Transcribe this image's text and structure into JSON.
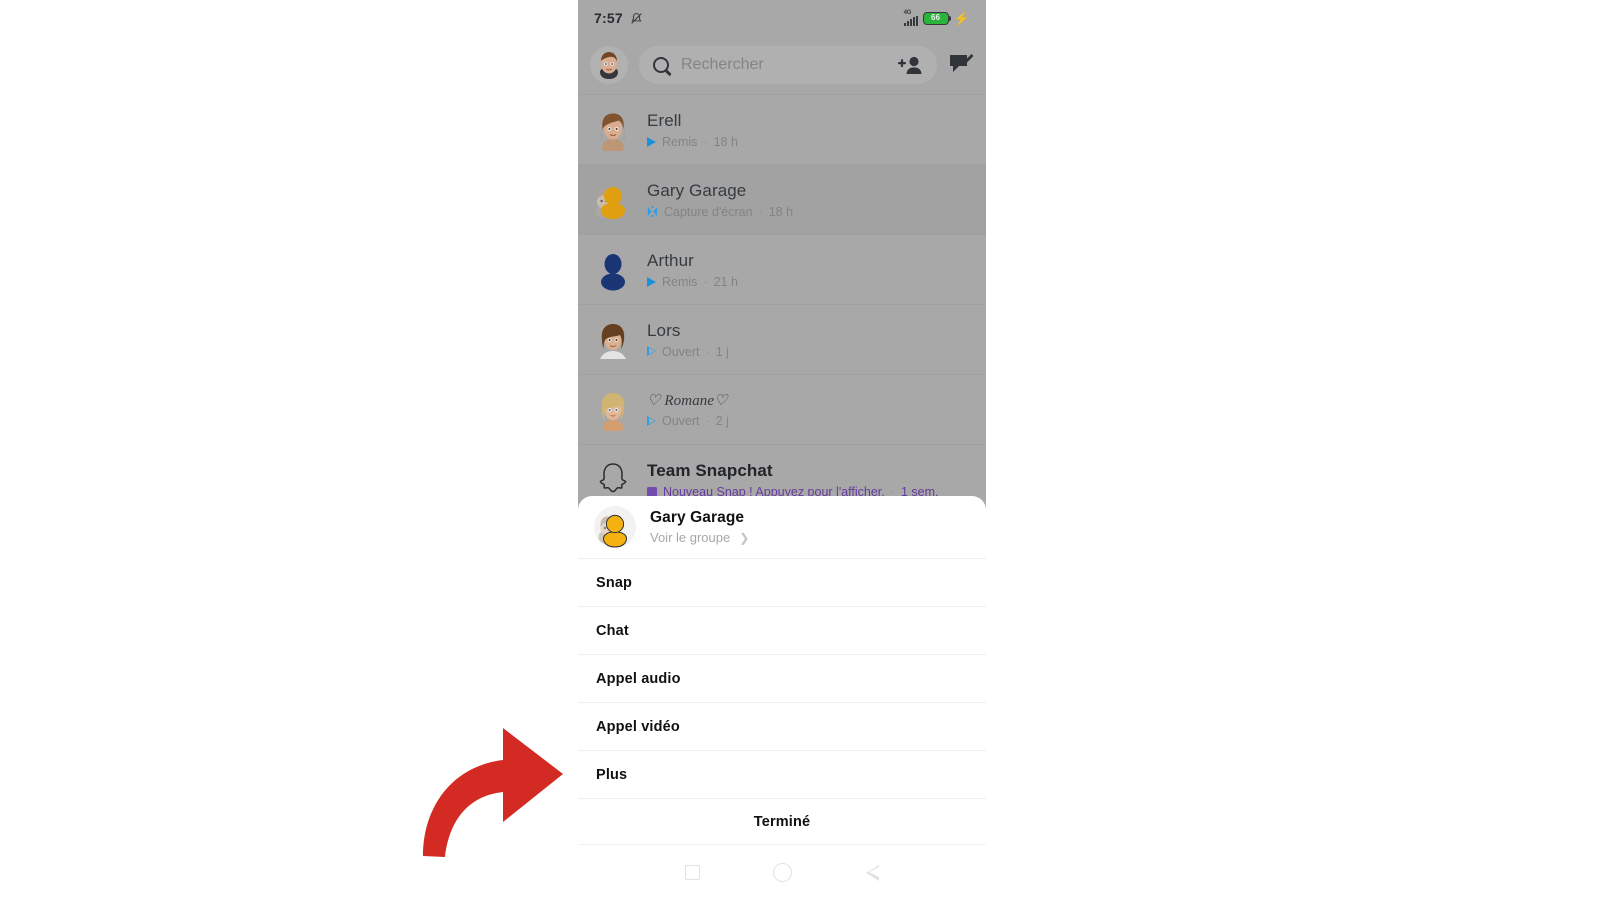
{
  "status_bar": {
    "time": "7:57",
    "mute_icon": "bell-mute-icon",
    "network_label": "4G",
    "battery_percent": "66",
    "charging_icon": "charging-bolt-icon"
  },
  "header": {
    "avatar_name": "my-bitmoji-avatar",
    "search_placeholder": "Rechercher",
    "search_value": "",
    "search_icon": "search-icon",
    "add_friend_icon": "add-friend-icon",
    "new_chat_icon": "new-chat-icon"
  },
  "chat_list": [
    {
      "name": "Erell",
      "status": "Remis",
      "time": "18 h",
      "separator": "·",
      "status_icon": "snap-sent-filled-icon",
      "avatar": "bitmoji-erell",
      "highlight": false,
      "unread": false
    },
    {
      "name": "Gary Garage",
      "status": "Capture d'écran",
      "time": "18 h",
      "separator": "·",
      "status_icon": "screenshot-icon",
      "avatar": "group-avatar-gary-garage",
      "highlight": true,
      "unread": false
    },
    {
      "name": "Arthur",
      "status": "Remis",
      "time": "21 h",
      "separator": "·",
      "status_icon": "snap-sent-filled-icon",
      "avatar": "default-avatar-arthur",
      "highlight": false,
      "unread": false
    },
    {
      "name": "Lors",
      "status": "Ouvert",
      "time": "1 j",
      "separator": "·",
      "status_icon": "snap-opened-outline-icon",
      "avatar": "bitmoji-lors",
      "highlight": false,
      "unread": false
    },
    {
      "name": "♡ Romane♡",
      "status": "Ouvert",
      "time": "2 j",
      "separator": "·",
      "status_icon": "snap-opened-outline-icon",
      "avatar": "bitmoji-romane",
      "highlight": false,
      "unread": false
    },
    {
      "name": "Team Snapchat",
      "status": "Nouveau Snap ! Appuyez pour l'afficher.",
      "time": "1 sem.",
      "separator": "·",
      "status_icon": "new-snap-purple-square-icon",
      "avatar": "snapchat-ghost-avatar",
      "highlight": false,
      "unread": true
    }
  ],
  "action_sheet": {
    "contact_name": "Gary Garage",
    "view_group_label": "Voir le groupe",
    "chevron_icon": "chevron-right-icon",
    "avatar": "group-avatar-gary-garage",
    "items": [
      {
        "label": "Snap"
      },
      {
        "label": "Chat"
      },
      {
        "label": "Appel audio"
      },
      {
        "label": "Appel vidéo"
      },
      {
        "label": "Plus"
      }
    ],
    "done_label": "Terminé"
  },
  "nav_bar": {
    "recents_icon": "square-recents-icon",
    "home_icon": "circle-home-icon",
    "back_icon": "triangle-back-icon"
  },
  "annotation": {
    "arrow_icon": "curved-red-arrow-icon",
    "arrow_color": "#d32b24",
    "points_to": "Plus"
  },
  "colors": {
    "phone_background": "#b3b3b3",
    "row_highlight": "#adadad",
    "sheet_background": "#ffffff",
    "accent_blue": "#1e9be8",
    "accent_purple": "#6c3fa8",
    "battery_green": "#2fbf3f",
    "annotation_red": "#d32b24"
  }
}
